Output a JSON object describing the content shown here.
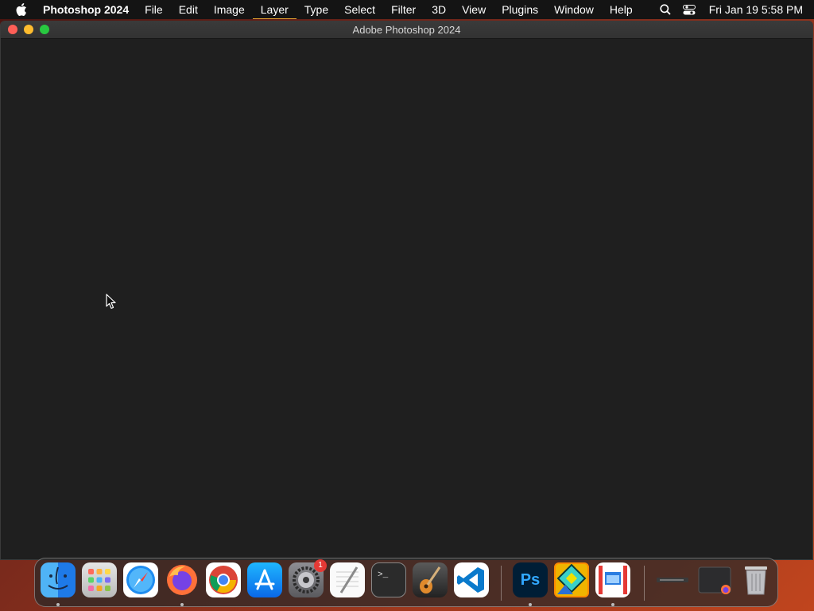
{
  "menubar": {
    "app_name": "Photoshop 2024",
    "items": [
      "File",
      "Edit",
      "Image",
      "Layer",
      "Type",
      "Select",
      "Filter",
      "3D",
      "View",
      "Plugins",
      "Window",
      "Help"
    ],
    "clock": "Fri Jan 19  5:58 PM"
  },
  "window": {
    "title": "Adobe Photoshop 2024"
  },
  "dock": {
    "items": [
      {
        "name": "finder",
        "running": true
      },
      {
        "name": "launchpad",
        "running": false
      },
      {
        "name": "safari",
        "running": false
      },
      {
        "name": "firefox",
        "running": true
      },
      {
        "name": "chrome",
        "running": false
      },
      {
        "name": "app-store",
        "running": false
      },
      {
        "name": "system-settings",
        "running": false,
        "badge": "1"
      },
      {
        "name": "textedit",
        "running": false
      },
      {
        "name": "terminal",
        "running": false
      },
      {
        "name": "garageband",
        "running": false
      },
      {
        "name": "vscode",
        "running": false
      },
      {
        "name": "photoshop",
        "running": true,
        "label": "Ps"
      },
      {
        "name": "geometry-dash",
        "running": false
      },
      {
        "name": "parallels",
        "running": true
      }
    ]
  },
  "colors": {
    "menubar_bg": "#141414",
    "window_bg": "#1f1f1f",
    "photoshop_blue": "#31a8ff"
  }
}
